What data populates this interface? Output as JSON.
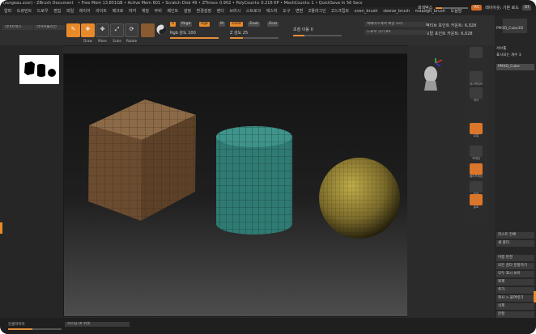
{
  "window": {
    "title_left": "(surgeau.zcor) - ZBrush Document",
    "title_stats": "• Free Mem 13.851GB • Active Mem 601 • Scratch Disk 49 • ZTime≥ 0.902 • PolyCount≥ 0.216 KP • MeshCount≥ 1 • QuickSave In 56 Secs",
    "menu_items": [
      "알파",
      "도큐먼트",
      "드로우",
      "편집",
      "파일",
      "레이어",
      "라이트",
      "매크로",
      "마커",
      "재질",
      "무비",
      "페인트",
      "설정",
      "환경설정",
      "렌더",
      "브러시",
      "스트로크",
      "텍스처",
      "도구",
      "변환",
      "Z플러그인",
      "Z스크립트"
    ],
    "menu_extra": [
      "oven_brush",
      "sleeve_brush",
      "maadgit_brush",
      "도움말"
    ],
    "right_label": "회색박스",
    "ac_label": "AC",
    "ui_label": "UI",
    "layout_label": "레이아웃: 기본 로드"
  },
  "toolbar": {
    "btn1": "라이트박스",
    "btn2": "라이브불리언",
    "edit": {
      "label": "Edit",
      "glyph": "✎"
    },
    "draw": {
      "label": "Draw",
      "glyph": "✚"
    },
    "move": {
      "label": "Move",
      "glyph": "✥"
    },
    "scale": {
      "label": "Scale",
      "glyph": "⤢"
    },
    "rotate": {
      "label": "Rotate",
      "glyph": "⟳"
    },
    "mrgb_a": "A",
    "mrgb": "Mrgb",
    "rgb": "Rgb",
    "m": "M",
    "zadd": "Zadd",
    "zsub": "Zsub",
    "zcut": "Zcut",
    "rgb_intensity": "Rgb 강도 100",
    "z_intensity": "Z 강도 25",
    "focal": "초점 이동 0",
    "draw_size": "드로우 크기 64",
    "dynamic": "다이나믹",
    "backface": "백페이스에서 확장 오리",
    "active_points": "액티브 포인트 카운트: 6,028",
    "total_points": "토탈 포인트 카운트: 6,028"
  },
  "shelf": {
    "persp": "퍼스펙티브",
    "floor": "바닥",
    "local": "로컬",
    "frame": "프레임",
    "move": "Move",
    "scale": "Scale",
    "rotate": "Rotate",
    "polyf": "폴리프레임",
    "transp": "투명",
    "solo": "솔로"
  },
  "right_panel": {
    "tool_name": "PM3D_Cube3D",
    "subtool_header": "서브툴",
    "visible_count": "표시되는 개수 3",
    "subtool_item": "PM3D_Cube",
    "items": [
      "리스트 전체",
      "새 폴더",
      "이름 변경",
      "모든 감다 분할하기",
      "모두 표시 보이",
      "복제",
      "추가",
      "복사 > 붙여넣기",
      "삭제",
      "분할",
      "병합"
    ]
  },
  "statusbar": {
    "label_left": "인클라이어",
    "label_mid": "커스텀 UI 위젯"
  },
  "viewport": {
    "objects": [
      "cube",
      "cylinder",
      "sphere"
    ],
    "colors": {
      "cube": "#7a5a3c",
      "cylinder": "#2f7a72",
      "sphere": "#8c7a32"
    }
  }
}
